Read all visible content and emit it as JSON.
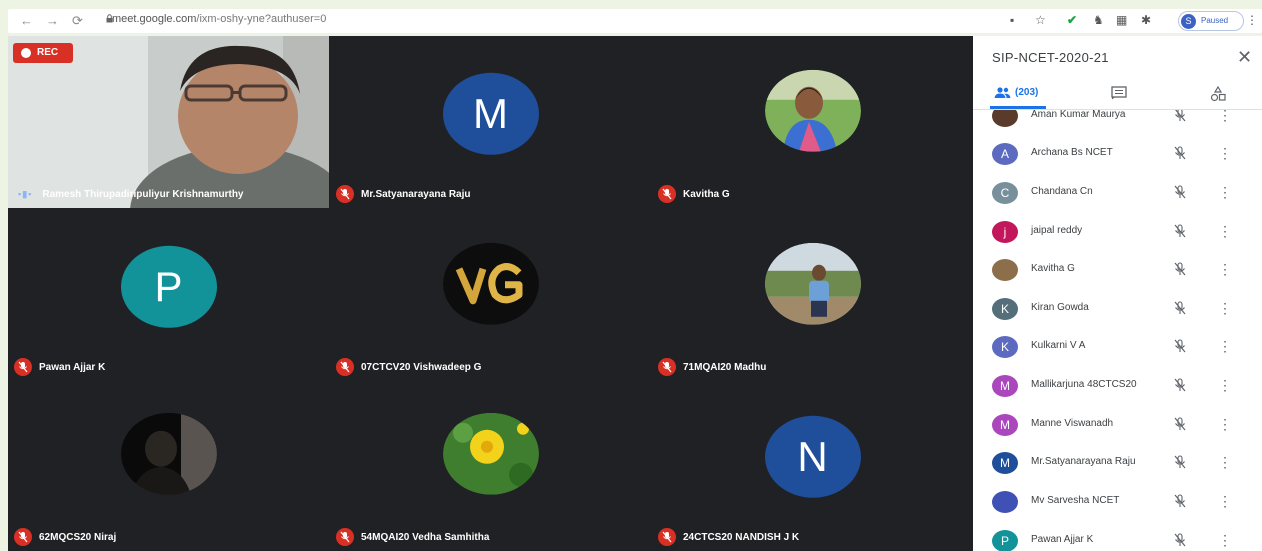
{
  "browser": {
    "url_host": "meet.google.com",
    "url_path": "/ixm-oshy-yne?authuser=0",
    "profile_initial": "S",
    "profile_status": "Paused"
  },
  "meeting": {
    "rec_label": "REC",
    "speaker_name": "Ramesh Thirupadiripuliyur Krishnamurthy",
    "tiles": [
      {
        "name": "Mr.Satyanarayana Raju",
        "letter": "M",
        "color": "#1f4e9a"
      },
      {
        "name": "Kavitha G"
      },
      {
        "name": "Pawan Ajjar K",
        "letter": "P",
        "color": "#12939a"
      },
      {
        "name": "07CTCV20 Vishwadeep G"
      },
      {
        "name": "71MQAI20 Madhu"
      },
      {
        "name": "62MQCS20 Niraj"
      },
      {
        "name": "54MQAI20 Vedha Samhitha"
      },
      {
        "name": "24CTCS20 NANDISH J K",
        "letter": "N",
        "color": "#1f4e9a"
      }
    ]
  },
  "panel": {
    "title": "SIP-NCET-2020-21",
    "people_count": "(203)",
    "participants": [
      {
        "name": "Aman Kumar Maurya",
        "initial": "",
        "color": "#5a3a2a"
      },
      {
        "name": "Archana Bs NCET",
        "initial": "A",
        "color": "#5c6bc0"
      },
      {
        "name": "Chandana Cn",
        "initial": "C",
        "color": "#78909c"
      },
      {
        "name": "jaipal reddy",
        "initial": "j",
        "color": "#c2185b"
      },
      {
        "name": "Kavitha G",
        "initial": "",
        "color": "#8d6e4a"
      },
      {
        "name": "Kiran Gowda",
        "initial": "K",
        "color": "#546e7a"
      },
      {
        "name": "Kulkarni V A",
        "initial": "K",
        "color": "#5c6bc0"
      },
      {
        "name": "Mallikarjuna 48CTCS20",
        "initial": "M",
        "color": "#ab47bc"
      },
      {
        "name": "Manne Viswanadh",
        "initial": "M",
        "color": "#ab47bc"
      },
      {
        "name": "Mr.Satyanarayana Raju",
        "initial": "M",
        "color": "#1f4e9a"
      },
      {
        "name": "Mv Sarvesha NCET",
        "initial": "",
        "color": "#3f51b5"
      },
      {
        "name": "Pawan Ajjar K",
        "initial": "P",
        "color": "#12939a"
      }
    ]
  }
}
